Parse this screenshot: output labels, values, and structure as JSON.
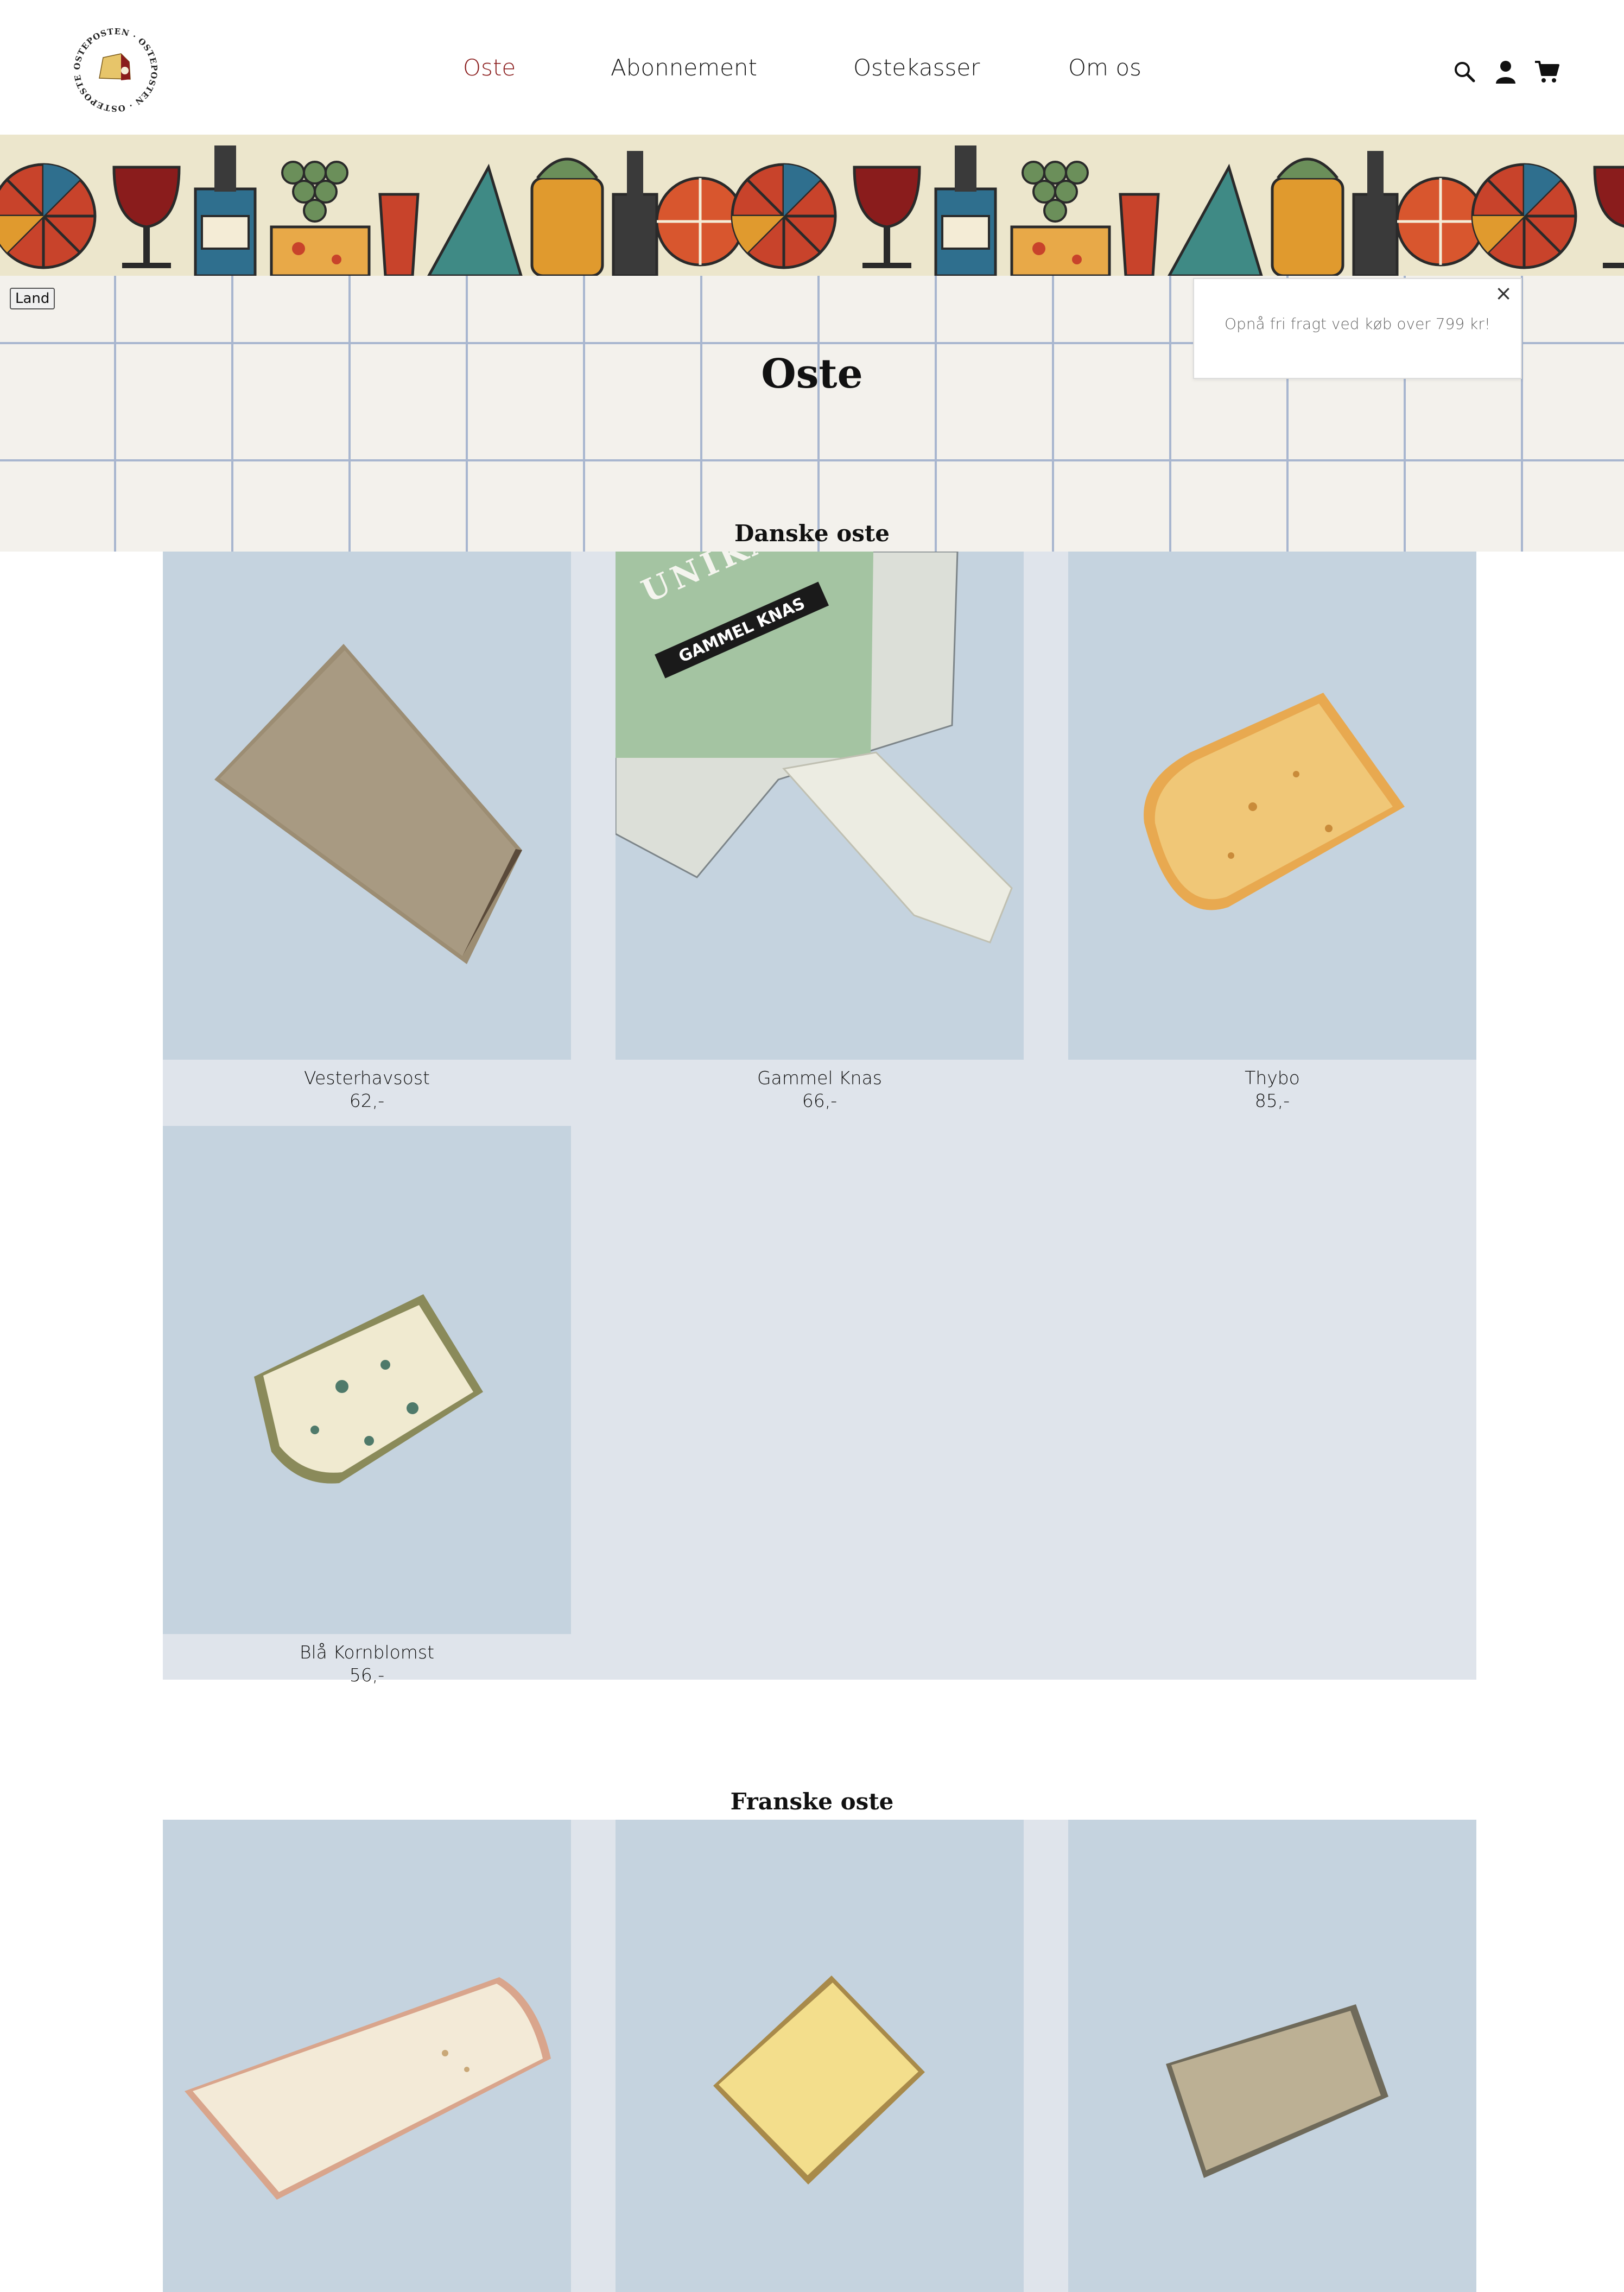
{
  "brand": {
    "logo_text": "OSTEPOSTEN"
  },
  "nav": {
    "items": [
      {
        "label": "Oste",
        "active": true
      },
      {
        "label": "Abonnement",
        "active": false
      },
      {
        "label": "Ostekasser",
        "active": false
      },
      {
        "label": "Om os",
        "active": false
      }
    ],
    "active_color": "#8a1c1c"
  },
  "header_icons": [
    "search-icon",
    "account-icon",
    "cart-icon"
  ],
  "filter": {
    "land_label": "Land"
  },
  "notice": {
    "text": "Opnå fri fragt ved køb over 799 kr!",
    "close": "×"
  },
  "page": {
    "title": "Oste"
  },
  "sections": [
    {
      "title": "Danske oste",
      "products": [
        {
          "name": "Vesterhavsost",
          "price": "62,-"
        },
        {
          "name": "Gammel Knas",
          "price": "66,-",
          "package_brand": "UNIKA",
          "package_label": "GAMMEL KNAS"
        },
        {
          "name": "Thybo",
          "price": "85,-"
        },
        {
          "name": "Blå Kornblomst",
          "price": "56,-"
        }
      ]
    },
    {
      "title": "Franske oste",
      "products": [
        {
          "name": "",
          "price": ""
        },
        {
          "name": "",
          "price": ""
        },
        {
          "name": "",
          "price": ""
        }
      ]
    }
  ],
  "colors": {
    "card_bg": "#c5d3df",
    "grid_bg": "#dfe4eb",
    "tile_line": "#a8b6cf"
  }
}
